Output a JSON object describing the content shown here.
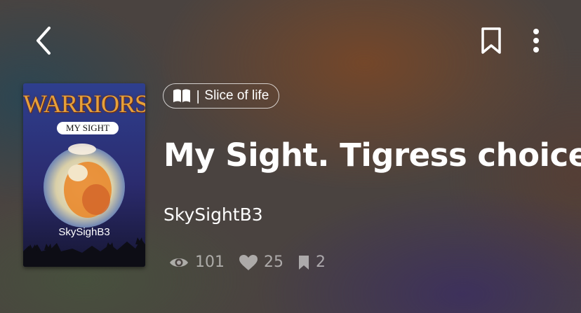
{
  "header": {
    "back_icon": "chevron-left-icon",
    "bookmark_icon": "bookmark-icon",
    "more_icon": "more-vertical-icon"
  },
  "cover": {
    "series_title": "WARRIORS",
    "banner_text": "MY SIGHT",
    "author_text": "SkySighB3"
  },
  "story": {
    "category": "Slice of life",
    "category_icon": "book-icon",
    "title": "My Sight. Tigress choice.",
    "author": "SkySightB3"
  },
  "stats": {
    "views": "101",
    "votes": "25",
    "parts": "2"
  },
  "colors": {
    "text": "#ffffff",
    "muted": "#a6a2a0",
    "cover_title": "#e7a13a"
  }
}
